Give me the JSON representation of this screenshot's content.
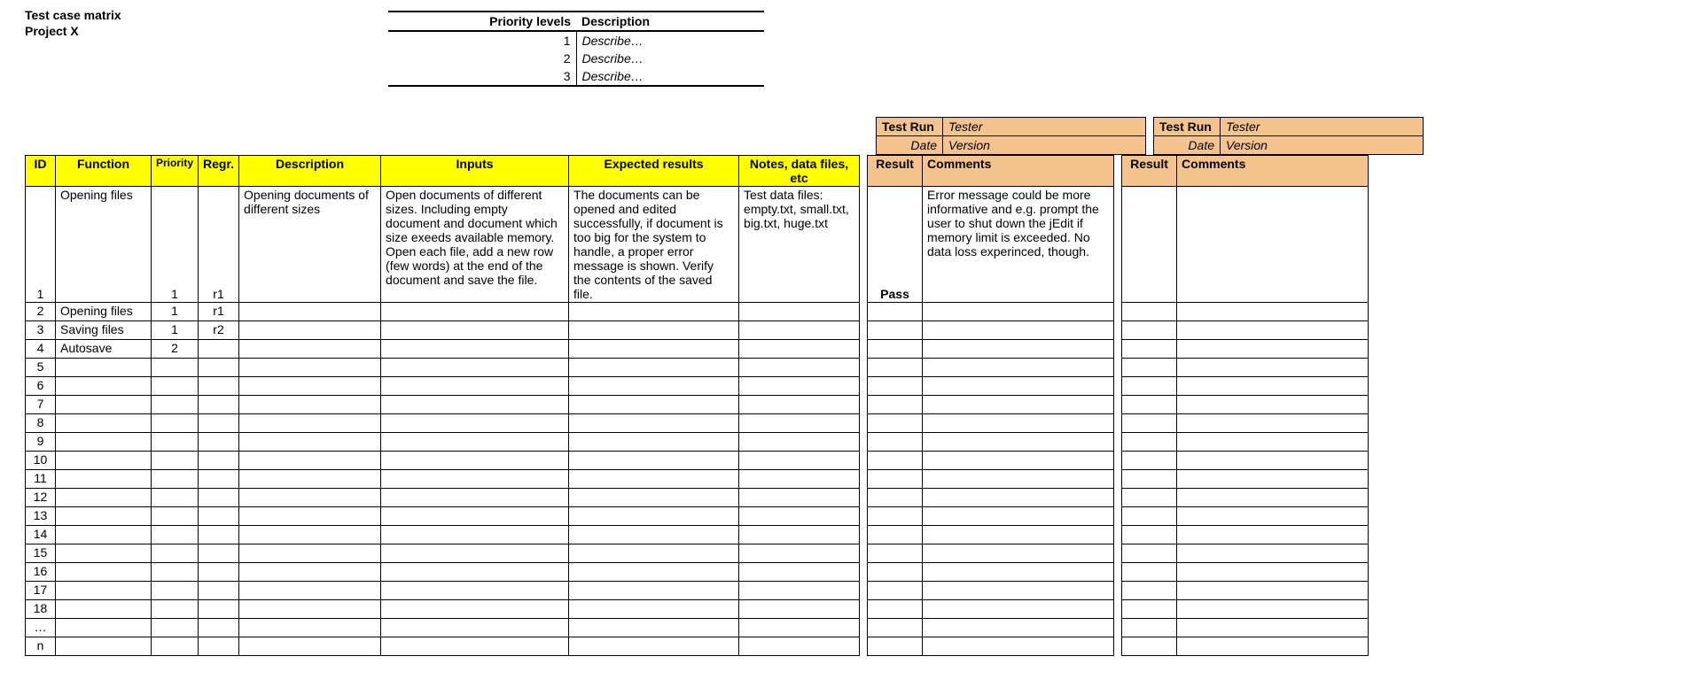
{
  "header": {
    "title": "Test case matrix",
    "project": "Project X"
  },
  "priority_table": {
    "headers": {
      "levels": "Priority levels",
      "desc": "Description"
    },
    "rows": [
      {
        "level": "1",
        "desc": "Describe…"
      },
      {
        "level": "2",
        "desc": "Describe…"
      },
      {
        "level": "3",
        "desc": "Describe…"
      }
    ]
  },
  "run_header": {
    "run1": {
      "test_run": "Test Run",
      "tester_lbl": "Tester",
      "date_lbl": "Date",
      "version_lbl": "Version",
      "tester": "",
      "date": "",
      "version": ""
    },
    "run2": {
      "test_run": "Test Run",
      "tester_lbl": "Tester",
      "date_lbl": "Date",
      "version_lbl": "Version",
      "tester": "",
      "date": "",
      "version": ""
    }
  },
  "matrix": {
    "headers": {
      "id": "ID",
      "fn": "Function",
      "priority": "Priority",
      "regr": "Regr.",
      "desc": "Description",
      "inputs": "Inputs",
      "expected": "Expected results",
      "notes": "Notes, data files, etc",
      "result": "Result",
      "comments": "Comments",
      "result2": "Result",
      "comments2": "Comments"
    },
    "rows": [
      {
        "id": "1",
        "fn": "Opening files",
        "priority": "1",
        "regr": "r1",
        "desc": "Opening documents of different sizes",
        "inputs": "Open documents of different sizes. Including empty document and document which size exeeds available memory. Open each file, add a new row (few words) at the end of the document and save the file.",
        "expected": "The documents can be opened and edited successfully, if document is too big for the system to handle, a proper error message is shown. Verify the contents of the saved file.",
        "notes": "Test data files: empty.txt, small.txt, big.txt, huge.txt",
        "result": "Pass",
        "comments": "Error message could be more informative and e.g. prompt the user to shut down the jEdit if memory limit is exceeded. No data loss experinced, though.",
        "result2": "",
        "comments2": ""
      },
      {
        "id": "2",
        "fn": "Opening files",
        "priority": "1",
        "regr": "r1",
        "desc": "",
        "inputs": "",
        "expected": "",
        "notes": "",
        "result": "",
        "comments": "",
        "result2": "",
        "comments2": ""
      },
      {
        "id": "3",
        "fn": "Saving files",
        "priority": "1",
        "regr": "r2",
        "desc": "",
        "inputs": "",
        "expected": "",
        "notes": "",
        "result": "",
        "comments": "",
        "result2": "",
        "comments2": ""
      },
      {
        "id": "4",
        "fn": "Autosave",
        "priority": "2",
        "regr": "",
        "desc": "",
        "inputs": "",
        "expected": "",
        "notes": "",
        "result": "",
        "comments": "",
        "result2": "",
        "comments2": ""
      },
      {
        "id": "5",
        "fn": "",
        "priority": "",
        "regr": "",
        "desc": "",
        "inputs": "",
        "expected": "",
        "notes": "",
        "result": "",
        "comments": "",
        "result2": "",
        "comments2": ""
      },
      {
        "id": "6",
        "fn": "",
        "priority": "",
        "regr": "",
        "desc": "",
        "inputs": "",
        "expected": "",
        "notes": "",
        "result": "",
        "comments": "",
        "result2": "",
        "comments2": ""
      },
      {
        "id": "7",
        "fn": "",
        "priority": "",
        "regr": "",
        "desc": "",
        "inputs": "",
        "expected": "",
        "notes": "",
        "result": "",
        "comments": "",
        "result2": "",
        "comments2": ""
      },
      {
        "id": "8",
        "fn": "",
        "priority": "",
        "regr": "",
        "desc": "",
        "inputs": "",
        "expected": "",
        "notes": "",
        "result": "",
        "comments": "",
        "result2": "",
        "comments2": ""
      },
      {
        "id": "9",
        "fn": "",
        "priority": "",
        "regr": "",
        "desc": "",
        "inputs": "",
        "expected": "",
        "notes": "",
        "result": "",
        "comments": "",
        "result2": "",
        "comments2": ""
      },
      {
        "id": "10",
        "fn": "",
        "priority": "",
        "regr": "",
        "desc": "",
        "inputs": "",
        "expected": "",
        "notes": "",
        "result": "",
        "comments": "",
        "result2": "",
        "comments2": ""
      },
      {
        "id": "11",
        "fn": "",
        "priority": "",
        "regr": "",
        "desc": "",
        "inputs": "",
        "expected": "",
        "notes": "",
        "result": "",
        "comments": "",
        "result2": "",
        "comments2": ""
      },
      {
        "id": "12",
        "fn": "",
        "priority": "",
        "regr": "",
        "desc": "",
        "inputs": "",
        "expected": "",
        "notes": "",
        "result": "",
        "comments": "",
        "result2": "",
        "comments2": ""
      },
      {
        "id": "13",
        "fn": "",
        "priority": "",
        "regr": "",
        "desc": "",
        "inputs": "",
        "expected": "",
        "notes": "",
        "result": "",
        "comments": "",
        "result2": "",
        "comments2": ""
      },
      {
        "id": "14",
        "fn": "",
        "priority": "",
        "regr": "",
        "desc": "",
        "inputs": "",
        "expected": "",
        "notes": "",
        "result": "",
        "comments": "",
        "result2": "",
        "comments2": ""
      },
      {
        "id": "15",
        "fn": "",
        "priority": "",
        "regr": "",
        "desc": "",
        "inputs": "",
        "expected": "",
        "notes": "",
        "result": "",
        "comments": "",
        "result2": "",
        "comments2": ""
      },
      {
        "id": "16",
        "fn": "",
        "priority": "",
        "regr": "",
        "desc": "",
        "inputs": "",
        "expected": "",
        "notes": "",
        "result": "",
        "comments": "",
        "result2": "",
        "comments2": ""
      },
      {
        "id": "17",
        "fn": "",
        "priority": "",
        "regr": "",
        "desc": "",
        "inputs": "",
        "expected": "",
        "notes": "",
        "result": "",
        "comments": "",
        "result2": "",
        "comments2": ""
      },
      {
        "id": "18",
        "fn": "",
        "priority": "",
        "regr": "",
        "desc": "",
        "inputs": "",
        "expected": "",
        "notes": "",
        "result": "",
        "comments": "",
        "result2": "",
        "comments2": ""
      },
      {
        "id": "…",
        "fn": "",
        "priority": "",
        "regr": "",
        "desc": "",
        "inputs": "",
        "expected": "",
        "notes": "",
        "result": "",
        "comments": "",
        "result2": "",
        "comments2": ""
      },
      {
        "id": "n",
        "fn": "",
        "priority": "",
        "regr": "",
        "desc": "",
        "inputs": "",
        "expected": "",
        "notes": "",
        "result": "",
        "comments": "",
        "result2": "",
        "comments2": ""
      }
    ]
  }
}
